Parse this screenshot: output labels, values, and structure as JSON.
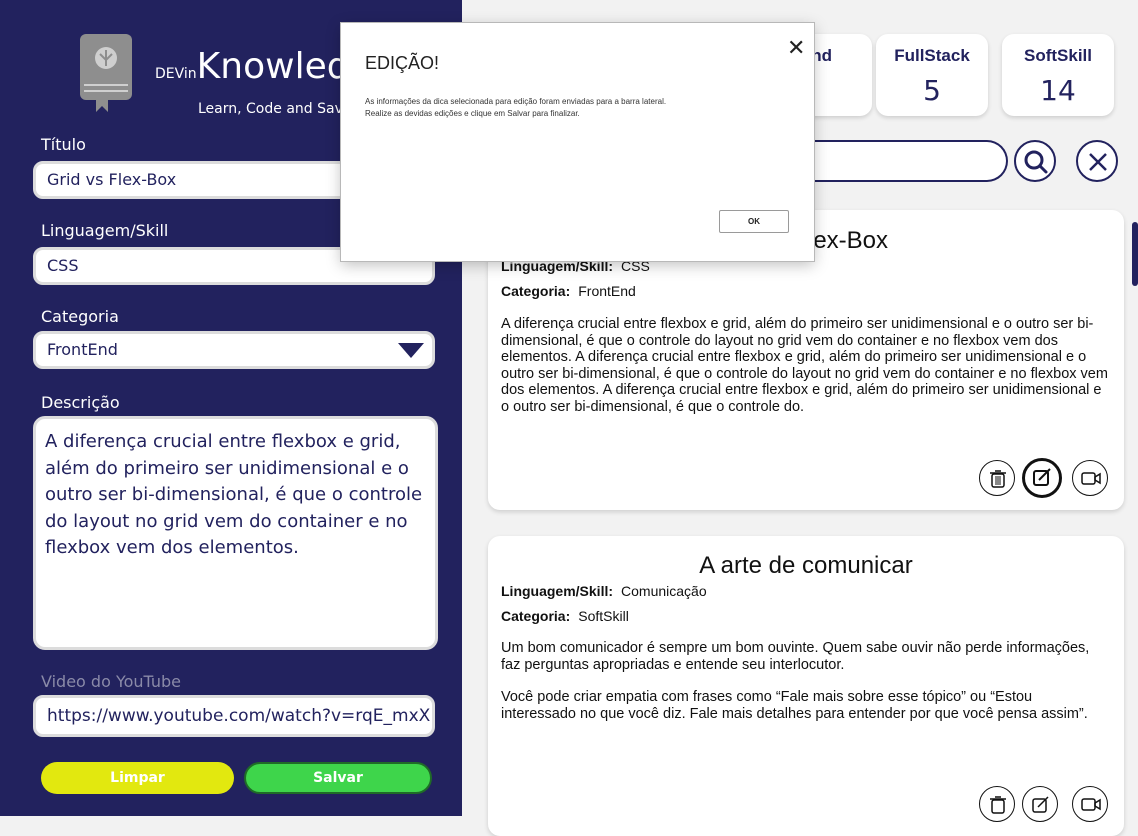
{
  "sidebar": {
    "brand_prefix": "DEVin",
    "brand_name": "Knowledge",
    "tagline": "Learn, Code and Save",
    "titulo_label": "Título",
    "titulo_value": "Grid vs Flex-Box",
    "linguagem_label": "Linguagem/Skill",
    "linguagem_value": "CSS",
    "categoria_label": "Categoria",
    "categoria_value": "FrontEnd",
    "descricao_label": "Descrição",
    "descricao_value": "A diferença crucial entre flexbox e grid, além do primeiro ser unidimensional e o outro ser bi-dimensional, é que o controle do layout no grid vem do container e no flexbox vem dos elementos.",
    "video_label": "Video do YouTube",
    "video_value": "https://www.youtube.com/watch?v=rqE_mxX",
    "clear_label": "Limpar",
    "save_label": "Salvar"
  },
  "stats": [
    {
      "label": "End",
      "value": ""
    },
    {
      "label": "FullStack",
      "value": "5"
    },
    {
      "label": "SoftSkill",
      "value": "14"
    }
  ],
  "cards": [
    {
      "title": "lex-Box",
      "lang_label": "Linguagem/Skill:",
      "lang_value": "CSS",
      "cat_label": "Categoria:",
      "cat_value": "FrontEnd",
      "description": "A diferença crucial entre flexbox e grid, além do primeiro ser unidimensional e o outro ser bi-dimensional, é que o controle do layout no grid vem do container e no flexbox vem dos elementos. A diferença crucial entre flexbox e grid, além do primeiro ser unidimensional e o outro ser bi-dimensional, é que o controle do layout no grid vem do container e no flexbox vem dos elementos. A diferença crucial entre flexbox e grid, além do primeiro ser unidimensional e o outro ser bi-dimensional, é que o controle do."
    },
    {
      "title": "A arte de comunicar",
      "lang_label": "Linguagem/Skill:",
      "lang_value": "Comunicação",
      "cat_label": "Categoria:",
      "cat_value": "SoftSkill",
      "description_p1": "Um bom comunicador é sempre um bom ouvinte. Quem sabe ouvir não perde informações, faz perguntas apropriadas e entende seu interlocutor.",
      "description_p2": "Você pode criar empatia com frases como “Fale mais sobre esse tópico” ou “Estou interessado no que você diz. Fale mais detalhes para entender por que você pensa assim”."
    }
  ],
  "dialog": {
    "title": "EDIÇÃO!",
    "close_glyph": "✕",
    "message_line1": "As informações da dica selecionada para edição foram enviadas para a barra lateral.",
    "message_line2": "Realize as devidas edições e clique em Salvar para finalizar.",
    "ok_label": "OK"
  },
  "colors": {
    "sidebar_bg": "#22225e",
    "clear_button": "#e2e80f",
    "save_button": "#3ed54b"
  }
}
